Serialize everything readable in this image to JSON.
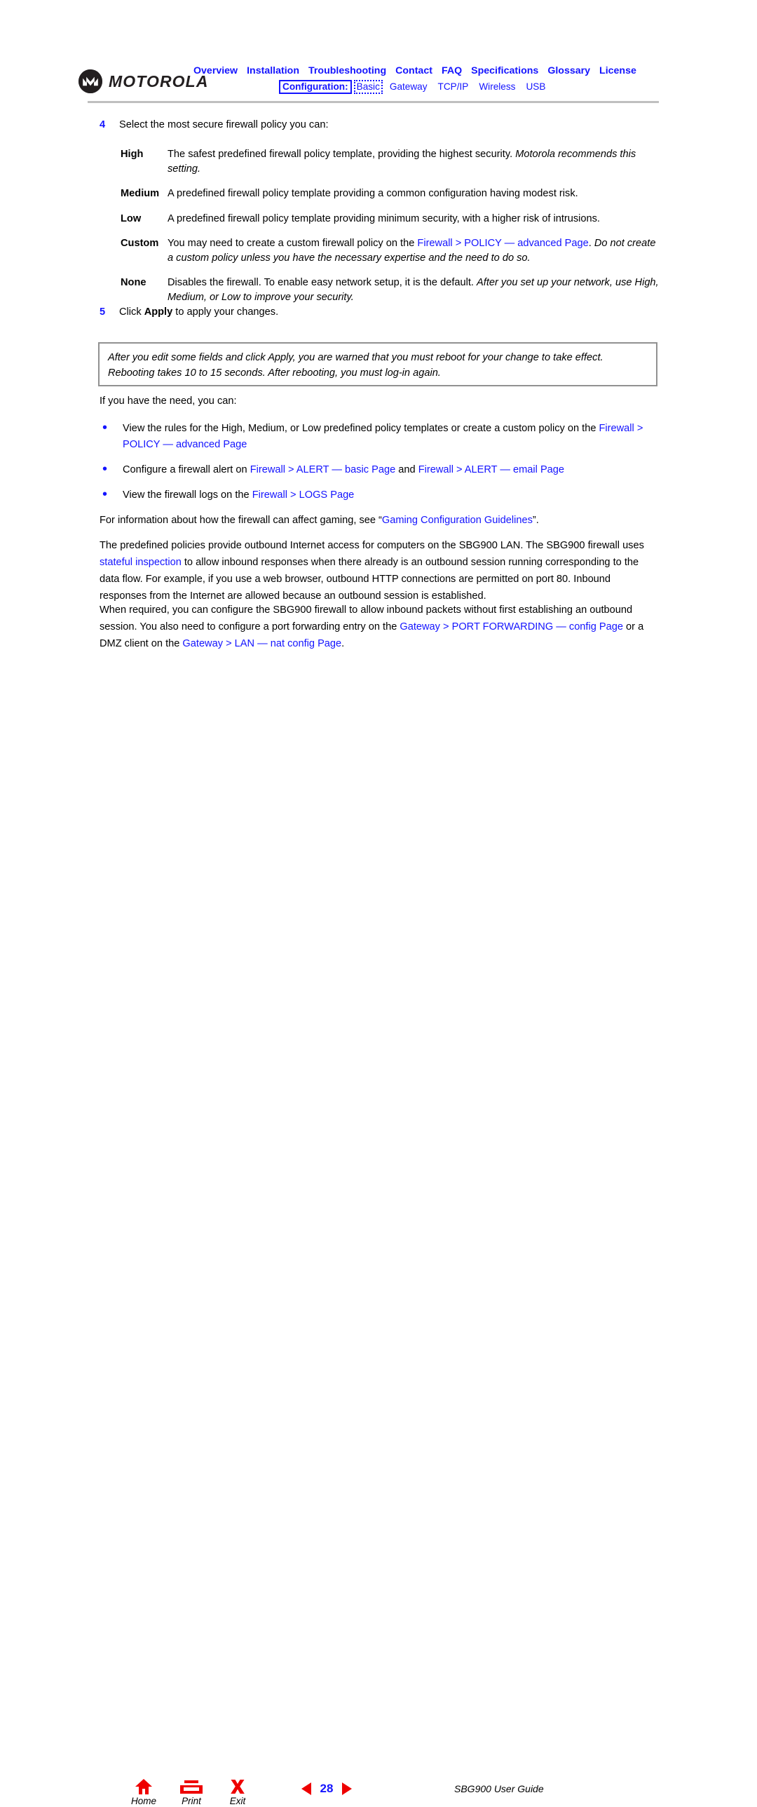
{
  "header": {
    "logo_text": "MOTOROLA",
    "nav_primary": [
      "Overview",
      "Installation",
      "Troubleshooting",
      "Contact",
      "FAQ",
      "Specifications",
      "Glossary",
      "License"
    ],
    "nav_secondary_label": "Configuration:",
    "nav_secondary": [
      "Basic",
      "Gateway",
      "TCP/IP",
      "Wireless",
      "USB"
    ],
    "nav_secondary_current": "Basic",
    "link_color": "#1414ff"
  },
  "steps": {
    "step4_num": "4",
    "step4_text": "Select the most secure firewall policy you can:",
    "step5_num": "5",
    "step5_text_pre": "Click ",
    "step5_bold": "Apply",
    "step5_text_post": " to apply your changes."
  },
  "policy_definitions": [
    {
      "term": "High",
      "plain1": "The safest predefined firewall policy template, providing the highest security. ",
      "italic1": "Motorola recommends this setting."
    },
    {
      "term": "Medium",
      "plain1": "A predefined firewall policy template providing a common configuration having modest risk.",
      "italic1": ""
    },
    {
      "term": "Low",
      "plain1": "A predefined firewall policy template providing minimum security, with a higher risk of intrusions.",
      "italic1": ""
    },
    {
      "term": "Custom",
      "plain1": "You may need to create a custom firewall policy on the ",
      "link1": "Firewall > POLICY — advanced Page",
      "plain2": ". ",
      "italic1": "Do not create a custom policy unless you have the necessary expertise and the need to do so."
    },
    {
      "term": "None",
      "plain1": "Disables the firewall. To enable easy network setup, it is the default. ",
      "italic1": "After you set up your network, use High, Medium, or Low to improve your security."
    }
  ],
  "notebox": {
    "line1": "After you edit some fields and click Apply, you are warned that you must reboot for your change to take effect.",
    "line2": "Rebooting takes 10 to 15 seconds. After rebooting, you must log-in again."
  },
  "need_intro": "If you have the need, you can:",
  "bullets": [
    {
      "marker": "•",
      "plain1": "View the rules for the High, Medium, or Low predefined policy templates or create a custom policy on the ",
      "link1": "Firewall > POLICY — advanced Page",
      "plain2": ""
    },
    {
      "marker": "•",
      "plain1": "Configure a firewall alert on ",
      "link1": "Firewall > ALERT — basic Page",
      "plain2": " and ",
      "link2": "Firewall > ALERT — email Page",
      "plain3": ""
    },
    {
      "marker": "•",
      "plain1": "View the firewall logs on the ",
      "link1": "Firewall > LOGS Page",
      "plain2": ""
    }
  ],
  "paragraphs": {
    "gaming_pre": "For information about how the firewall can affect gaming, see “",
    "gaming_link": "Gaming Configuration Guidelines",
    "gaming_post": "”.",
    "stateful_pre": "The predefined policies provide outbound Internet access for computers on the SBG900 LAN. The SBG900 firewall uses ",
    "stateful_link": "stateful inspection",
    "stateful_post": " to allow inbound responses when there already is an outbound session running corresponding to the data flow. For example, if you use a web browser, outbound HTTP connections are permitted on port 80. Inbound responses from the Internet are allowed because an outbound session is established.",
    "inbound_pre": "When required, you can configure the SBG900 firewall to allow inbound packets without first establishing an outbound session. You also need to configure a port forwarding entry on the ",
    "inbound_link1": "Gateway > PORT FORWARDING — config Page",
    "inbound_mid": " or a DMZ client on the ",
    "inbound_link2": "Gateway > LAN — nat config Page",
    "inbound_post": "."
  },
  "footer": {
    "home_label": "Home",
    "print_label": "Print",
    "exit_label": "Exit",
    "exit_glyph": "X",
    "page_number": "28",
    "guide_title": "SBG900 User Guide",
    "icon_color": "#ee0000",
    "page_number_color": "#1414ff"
  }
}
